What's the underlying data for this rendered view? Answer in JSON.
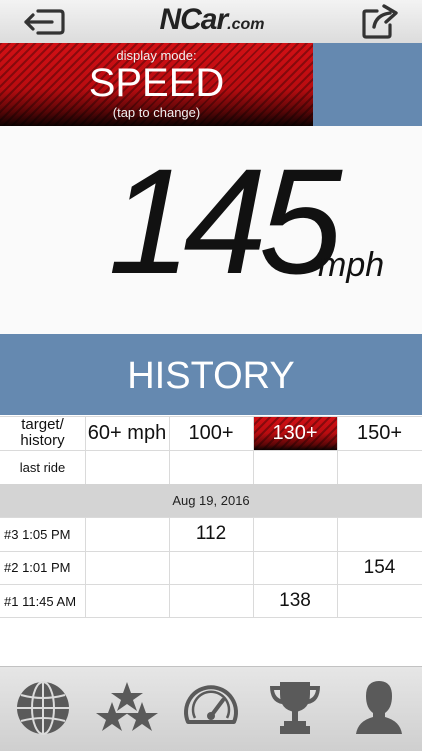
{
  "header": {
    "logo_main": "NCar",
    "logo_domain": ".com"
  },
  "mode": {
    "label": "display mode:",
    "value": "SPEED",
    "hint": "(tap to change)"
  },
  "speed": {
    "value": "145",
    "unit": "mph"
  },
  "history": {
    "title": "HISTORY",
    "header_label": "target/\nhistory",
    "columns": [
      "60+ mph",
      "100+",
      "130+",
      "150+"
    ],
    "active_column": "130+",
    "last_ride_label": "last ride",
    "date": "Aug 19, 2016",
    "rows": [
      {
        "label": "#3 1:05 PM",
        "values": [
          "",
          "112",
          "",
          ""
        ]
      },
      {
        "label": "#2 1:01 PM",
        "values": [
          "",
          "",
          "",
          "154"
        ]
      },
      {
        "label": "#1 11:45 AM",
        "values": [
          "",
          "",
          "138",
          ""
        ]
      }
    ]
  },
  "tabs": [
    "globe-icon",
    "stars-icon",
    "speedometer-icon",
    "trophy-icon",
    "profile-icon"
  ],
  "colors": {
    "accent_red": "#c41015",
    "accent_blue": "#6589b0"
  }
}
